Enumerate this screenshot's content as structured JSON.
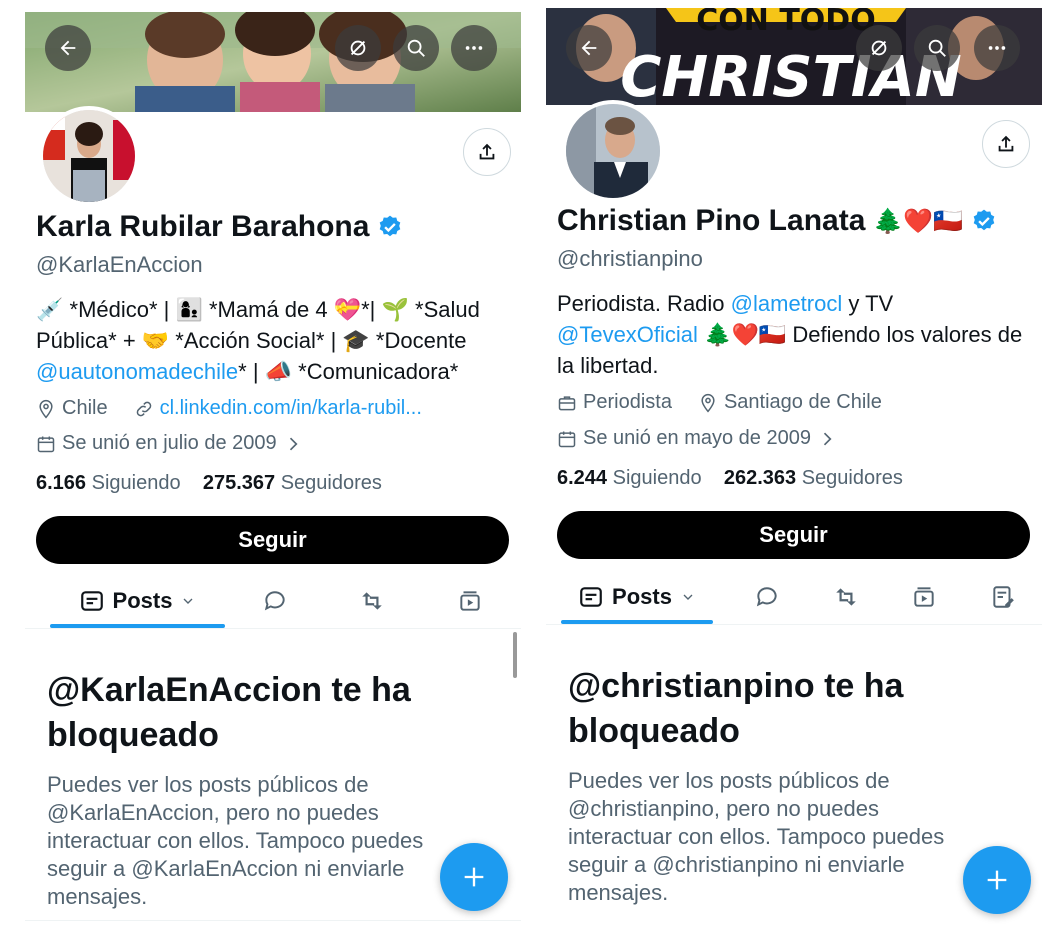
{
  "left": {
    "name": "Karla Rubilar Barahona",
    "handle": "@KarlaEnAccion",
    "bio_parts": [
      {
        "t": "💉 *Médico* | 👩‍👦 *Mamá de 4 💝*| 🌱 *Salud Pública* + 🤝 *Acción Social* | 🎓 *Docente ",
        "link": false
      },
      {
        "t": "@uautonomadechile",
        "link": true
      },
      {
        "t": "* | 📣 *Comunicadora*",
        "link": false
      }
    ],
    "location": "Chile",
    "website": "cl.linkedin.com/in/karla-rubil...",
    "joined": "Se unió en julio de 2009",
    "following_count": "6.166",
    "following_label": "Siguiendo",
    "followers_count": "275.367",
    "followers_label": "Seguidores",
    "follow_button": "Seguir",
    "tab_posts": "Posts",
    "blocked_title": "@KarlaEnAccion te ha bloqueado",
    "blocked_text": "Puedes ver los posts públicos de @KarlaEnAccion, pero no puedes interactuar con ellos. Tampoco puedes seguir a @KarlaEnAccion ni enviarle mensajes."
  },
  "right": {
    "name": "Christian Pino Lanata",
    "name_emojis": "🌲❤️🇨🇱",
    "handle": "@christianpino",
    "banner_text_top": "CON TODO",
    "banner_text_main": "CHRISTIAN",
    "bio_parts": [
      {
        "t": "Periodista. Radio ",
        "link": false
      },
      {
        "t": "@lametrocl",
        "link": true
      },
      {
        "t": " y TV ",
        "link": false
      },
      {
        "t": "@TevexOficial",
        "link": true
      },
      {
        "t": " 🌲❤️🇨🇱 Defiendo los valores de la libertad.",
        "link": false
      }
    ],
    "profession": "Periodista",
    "location": "Santiago de Chile",
    "joined": "Se unió en mayo de 2009",
    "following_count": "6.244",
    "following_label": "Siguiendo",
    "followers_count": "262.363",
    "followers_label": "Seguidores",
    "follow_button": "Seguir",
    "tab_posts": "Posts",
    "blocked_title": "@christianpino te ha bloqueado",
    "blocked_text": "Puedes ver los posts públicos de @christianpino, pero no puedes interactuar con ellos. Tampoco puedes seguir a @christianpino ni enviarle mensajes."
  },
  "colors": {
    "accent": "#1d9bf0",
    "text": "#0f1419",
    "muted": "#536471",
    "button_bg": "#000000"
  },
  "icons": [
    "back-arrow-icon",
    "hide-icon",
    "search-icon",
    "more-icon",
    "share-icon",
    "verified-badge-icon",
    "location-icon",
    "link-icon",
    "calendar-icon",
    "briefcase-icon",
    "chevron-right-icon",
    "posts-icon",
    "chevron-down-icon",
    "reply-icon",
    "repost-icon",
    "media-icon",
    "articles-icon",
    "plus-icon"
  ]
}
